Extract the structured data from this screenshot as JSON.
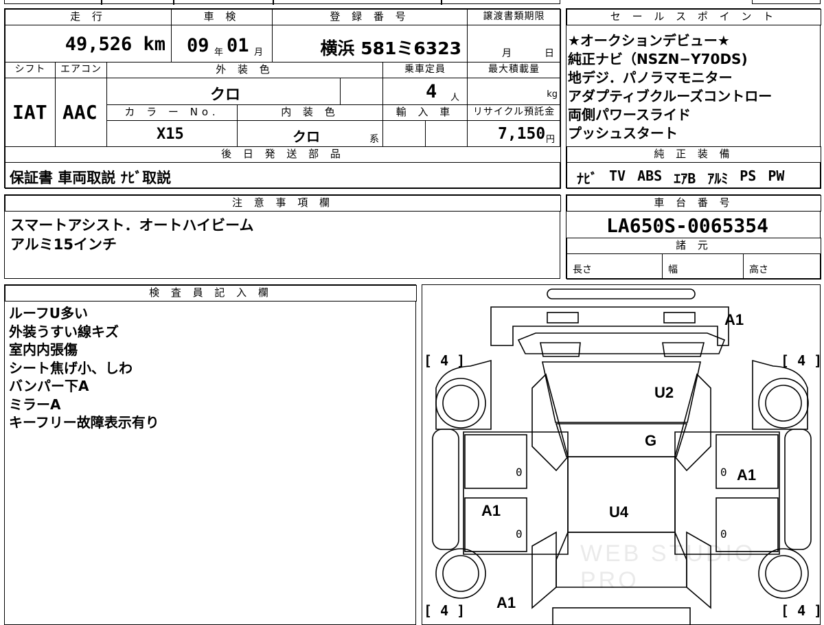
{
  "top_strip": [
    "",
    "",
    "",
    ""
  ],
  "mileage": {
    "header": "走 行",
    "value": "49,526 km"
  },
  "shaken": {
    "header": "車 検",
    "year": "09",
    "year_unit": "年",
    "month": "01",
    "month_unit": "月"
  },
  "registration": {
    "header": "登 録 番 号",
    "value": "横浜 581ミ6323"
  },
  "transfer": {
    "header": "譲渡書類期限",
    "month_unit": "月",
    "day_unit": "日"
  },
  "shift": {
    "header": "シフト",
    "value": "IAT"
  },
  "aircon": {
    "header": "エアコン",
    "value": "AAC"
  },
  "exterior_color": {
    "header": "外 装 色",
    "value": "クロ"
  },
  "capacity": {
    "header": "乗車定員",
    "value": "4",
    "unit": "人"
  },
  "max_load": {
    "header": "最大積載量",
    "unit": "kg"
  },
  "color_no": {
    "header": "カ ラ ー No.",
    "value": "X15"
  },
  "interior_color": {
    "header": "内 装 色",
    "value": "クロ",
    "suffix": "系"
  },
  "import_car": {
    "header": "輸 入 車"
  },
  "recycle": {
    "header": "リサイクル預託金",
    "value": "7,150",
    "unit": "円"
  },
  "later_parts": {
    "header": "後 日 発 送 部 品",
    "value": "保証書 車両取説 ﾅﾋﾞ取説"
  },
  "sales_points": {
    "header": "セ ー ル ス ポ イ ン ト",
    "lines": [
      "★オークションデビュー★",
      "純正ナビ（NSZN−Y70DS)",
      "地デジ．パノラマモニター",
      "アダプティブクルーズコントロー",
      "両側パワースライド",
      "プッシュスタート"
    ]
  },
  "genuine_equipment": {
    "header": "純 正 装 備",
    "items": [
      "ﾅﾋﾞ",
      "TV",
      "ABS",
      "ｴｱB",
      "ｱﾙﾐ",
      "PS",
      "PW"
    ]
  },
  "notes": {
    "header": "注 意 事 項 欄",
    "lines": [
      "スマートアシスト．オートハイビーム",
      "アルミ15インチ"
    ]
  },
  "chassis": {
    "header": "車 台 番 号",
    "value": "LA650S-0065354"
  },
  "specs": {
    "header": "諸 元",
    "length": "長さ",
    "width": "幅",
    "height": "高さ"
  },
  "inspector": {
    "header": "検 査 員 記 入 欄",
    "lines": [
      "ルーフU多い",
      "外装うすい線キズ",
      "室内内張傷",
      "シート焦げ小、しわ",
      "バンパー下A",
      "ミラーA",
      "キーフリー故障表示有り"
    ]
  },
  "diagram": {
    "tires": [
      "[ 4 ]",
      "[ 4 ]",
      "[ 4 ]",
      "[ 4 ]"
    ],
    "marks": {
      "front_right": "A1",
      "roof": "U2",
      "glass": "G",
      "right_side": "A1",
      "left_side": "A1",
      "center": "U4",
      "rear_left": "A1"
    },
    "zeros": [
      "0",
      "0",
      "0",
      "0"
    ],
    "watermark": "WEB STUDIO PRO"
  }
}
